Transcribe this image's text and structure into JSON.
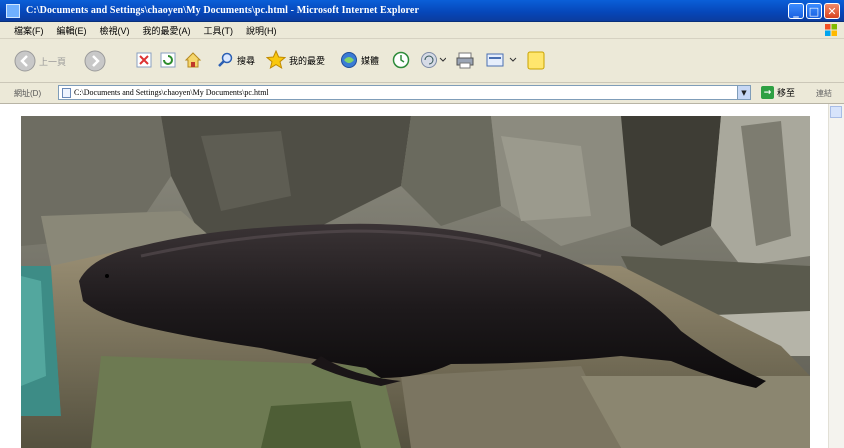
{
  "window": {
    "title": "C:\\Documents and Settings\\chaoyen\\My Documents\\pc.html - Microsoft Internet Explorer",
    "minimize": "_",
    "maximize": "□",
    "close": "✕"
  },
  "menu": {
    "items": [
      "檔案(F)",
      "編輯(E)",
      "檢視(V)",
      "我的最愛(A)",
      "工具(T)",
      "說明(H)"
    ]
  },
  "toolbar": {
    "back": "上一頁",
    "search_label": "搜尋",
    "favorites_label": "我的最愛",
    "media_label": "媒體"
  },
  "address": {
    "label": "網址(D)",
    "value": "C:\\Documents and Settings\\chaoyen\\My Documents\\pc.html",
    "go_label": "移至",
    "links_label": "連結"
  },
  "icons": {
    "back": "back-arrow-icon",
    "forward": "forward-arrow-icon",
    "stop": "stop-icon",
    "refresh": "refresh-icon",
    "home": "home-icon",
    "search": "search-icon",
    "favorites": "star-icon",
    "media": "media-icon",
    "history": "history-icon",
    "mail": "mail-icon",
    "print": "print-icon",
    "edit": "edit-icon",
    "messenger": "folder-icon"
  },
  "colors": {
    "titlebar": "#0646b8",
    "chrome": "#ece9d8",
    "close": "#d8431f"
  }
}
